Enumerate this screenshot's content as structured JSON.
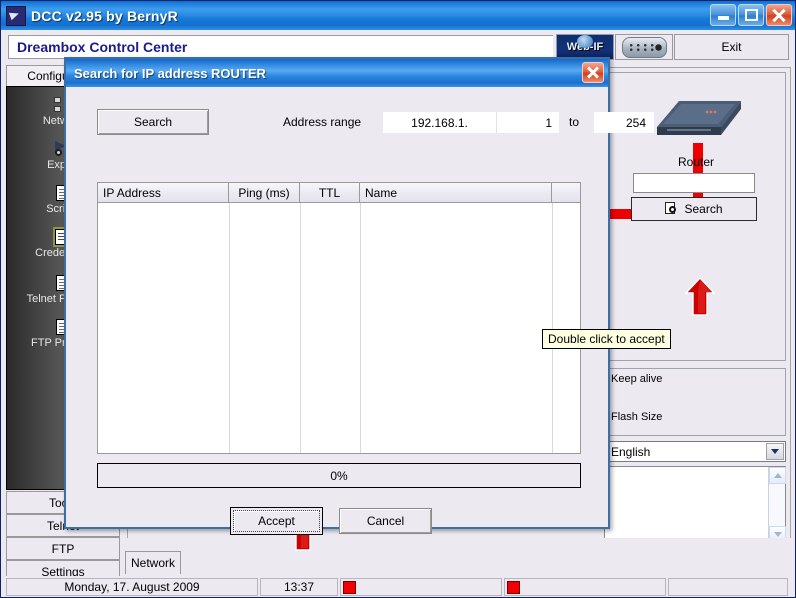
{
  "window": {
    "title": "DCC v2.95 by BernyR",
    "minimize_label": "minimize",
    "maximize_label": "maximize",
    "close_label": "close"
  },
  "header": {
    "title": "Dreambox Control Center",
    "webif_label": "Web-IF",
    "remote_label": "remote-control",
    "exit_label": "Exit"
  },
  "sidebar": {
    "tab_label": "Configuration",
    "items": [
      {
        "label": "Network",
        "icon": "network-icon"
      },
      {
        "label": "Expert",
        "icon": "expert-icon"
      },
      {
        "label": "Scripts",
        "icon": "document-icon"
      },
      {
        "label": "Credentials",
        "icon": "credentials-icon"
      },
      {
        "label": "Telnet Protocol",
        "icon": "document-icon"
      },
      {
        "label": "FTP Protocol",
        "icon": "document-icon"
      }
    ],
    "bottom_buttons": [
      "Tools",
      "Telnet",
      "FTP",
      "Settings"
    ]
  },
  "main": {
    "device": {
      "name": "Router",
      "address_value": "",
      "search_label": "Search",
      "search_icon": "magnifier-icon"
    },
    "alive_text": "Keep alive",
    "flash_text": "Flash Size",
    "language": {
      "selected": "English",
      "arrow_icon": "chevron-down-icon"
    },
    "log_text": "",
    "tab_label": "Network"
  },
  "tooltip": {
    "text": "Double click to accept"
  },
  "dialog": {
    "title": "Search for IP address ROUTER",
    "close_label": "close",
    "search_label": "Search",
    "address_range_label": "Address range",
    "address_prefix": "192.168.1.",
    "address_from": "1",
    "to_label": "to",
    "address_to": "254",
    "grid": {
      "columns": [
        "IP Address",
        "Ping (ms)",
        "TTL",
        "Name",
        ""
      ],
      "rows": []
    },
    "progress_text": "0%",
    "accept_label": "Accept",
    "cancel_label": "Cancel"
  },
  "statusbar": {
    "date": "Monday, 17. August 2009",
    "time": "13:37",
    "indicator1": "red",
    "indicator2": "red",
    "extra": ""
  },
  "colors": {
    "title_blue": "#2d88e2",
    "accent_red": "#ee0000",
    "header_text": "#1b1b8f",
    "tooltip_bg": "#ffffe1"
  }
}
